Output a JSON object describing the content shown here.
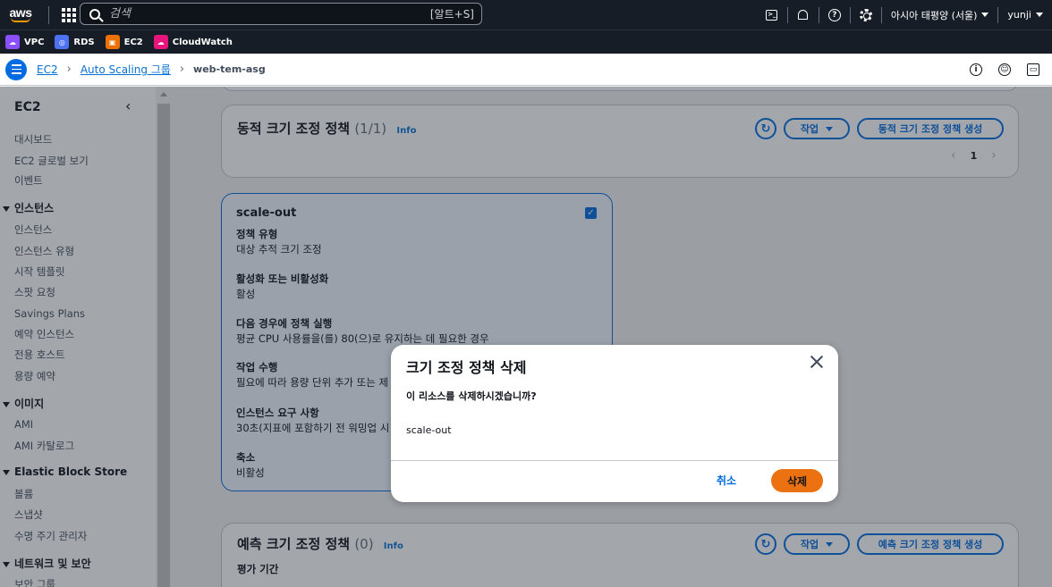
{
  "topbar": {
    "logo": "aws",
    "search_placeholder": "검색",
    "search_shortcut": "[알트+S]",
    "region": "아시아 태평양 (서울)",
    "user": "yunji"
  },
  "favorites": [
    {
      "label": "VPC",
      "color": "#8c4fff"
    },
    {
      "label": "RDS",
      "color": "#4d72f3"
    },
    {
      "label": "EC2",
      "color": "#ed7100"
    },
    {
      "label": "CloudWatch",
      "color": "#e7157b"
    }
  ],
  "breadcrumb": {
    "items": [
      "EC2",
      "Auto Scaling 그룹"
    ],
    "current": "web-tem-asg"
  },
  "sidebar": {
    "title": "EC2",
    "top_items": [
      "대시보드",
      "EC2 글로벌 보기",
      "이벤트"
    ],
    "sections": [
      {
        "title": "인스턴스",
        "items": [
          "인스턴스",
          "인스턴스 유형",
          "시작 템플릿",
          "스팟 요청",
          "Savings Plans",
          "예약 인스턴스",
          "전용 호스트",
          "용량 예약"
        ]
      },
      {
        "title": "이미지",
        "items": [
          "AMI",
          "AMI 카탈로그"
        ]
      },
      {
        "title": "Elastic Block Store",
        "items": [
          "볼륨",
          "스냅샷",
          "수명 주기 관리자"
        ]
      },
      {
        "title": "네트워크 및 보안",
        "items": [
          "보안 그룹"
        ]
      }
    ]
  },
  "dynamic_panel": {
    "title": "동적 크기 조정 정책",
    "count": "(1/1)",
    "info": "Info",
    "actions_label": "작업",
    "create_label": "동적 크기 조정 정책 생성",
    "page": "1"
  },
  "policy_card": {
    "name": "scale-out",
    "fields": [
      {
        "key": "정책 유형",
        "value": "대상 추적 크기 조정"
      },
      {
        "key": "활성화 또는 비활성화",
        "value": "활성"
      },
      {
        "key": "다음 경우에 정책 실행",
        "value": "평균 CPU 사용률을(를) 80(으)로 유지하는 데 필요한 경우"
      },
      {
        "key": "작업 수행",
        "value": "필요에 따라 용량 단위 추가 또는 제"
      },
      {
        "key": "인스턴스 요구 사항",
        "value": "30초(지표에 포함하기 전 워밍업 시"
      },
      {
        "key": "축소",
        "value": "비활성"
      }
    ]
  },
  "predictive_panel": {
    "title": "예측 크기 조정 정책",
    "count": "(0)",
    "info": "Info",
    "actions_label": "작업",
    "create_label": "예측 크기 조정 정책 생성",
    "eval_label": "평가 기간"
  },
  "modal": {
    "title": "크기 조정 정책 삭제",
    "question": "이 리소스를 삭제하시겠습니까?",
    "resource": "scale-out",
    "cancel_label": "취소",
    "delete_label": "삭제"
  }
}
